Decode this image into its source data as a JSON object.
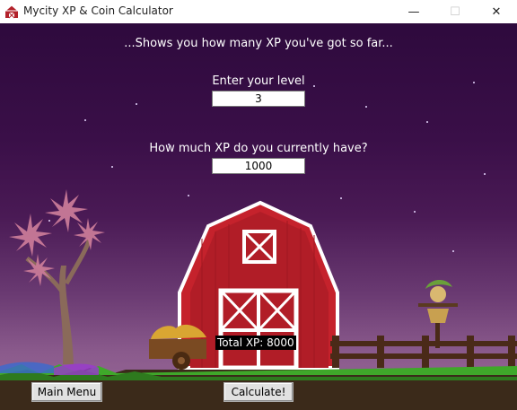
{
  "window": {
    "title": "Mycity XP & Coin Calculator",
    "minimize_glyph": "—",
    "maximize_glyph": "☐",
    "close_glyph": "✕",
    "app_icon": "barn-icon"
  },
  "main": {
    "heading": "...Shows you how many XP you've got so far...",
    "level_label": "Enter your level",
    "level_value": "3",
    "xp_label": "How much XP do you currently have?",
    "xp_value": "1000",
    "total_xp": "Total XP: 8000"
  },
  "buttons": {
    "main_menu": "Main Menu",
    "calculate": "Calculate!"
  },
  "colors": {
    "sky_top": "#2e0a3d",
    "barn_red": "#c0202a",
    "grass": "#3fa82a"
  }
}
